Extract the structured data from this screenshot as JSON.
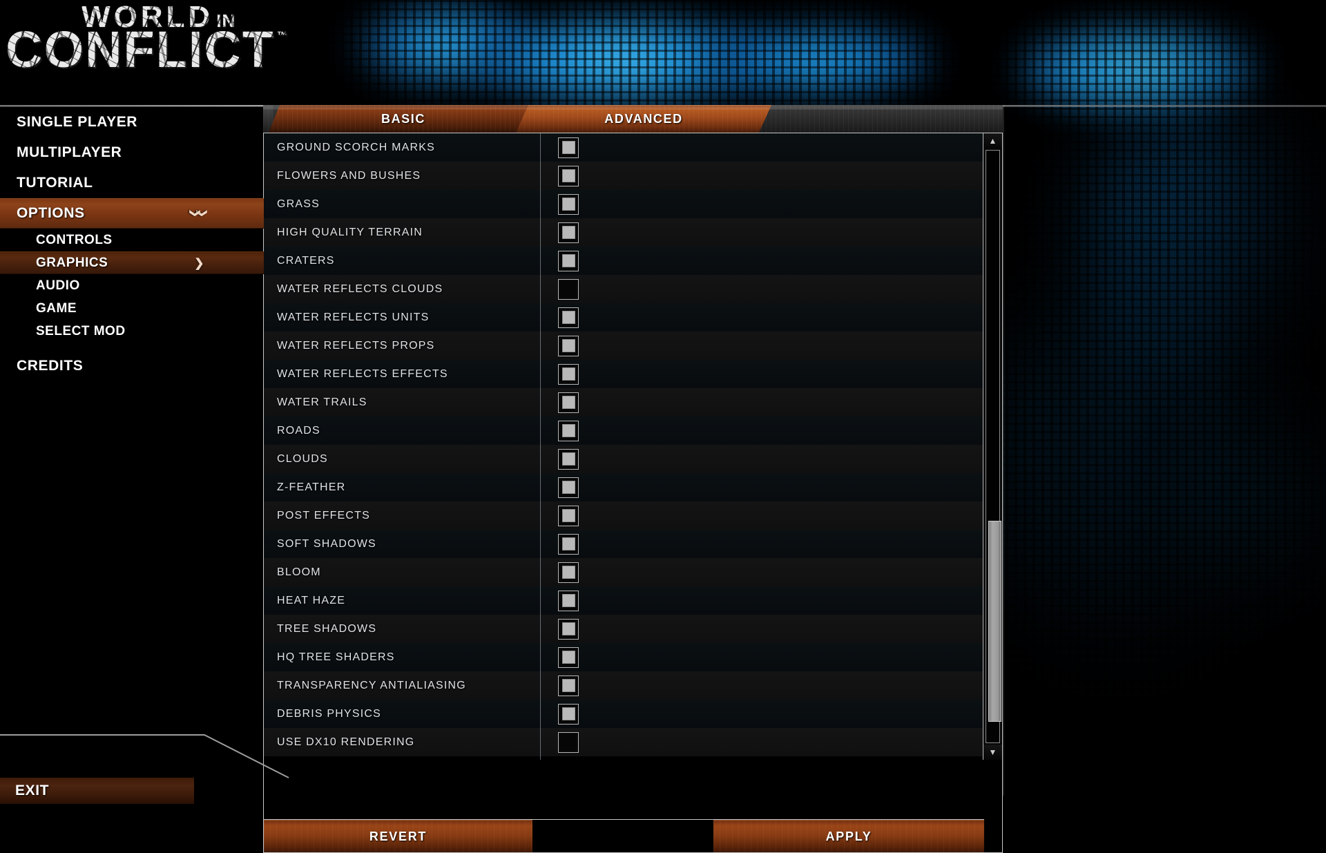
{
  "app": {
    "logo_line1": "WORLD",
    "logo_in": "IN",
    "logo_line2": "CONFLICT",
    "logo_tm": "™"
  },
  "sidebar": {
    "items": [
      {
        "label": "SINGLE PLAYER",
        "level": "top",
        "state": "normal",
        "chevron": ""
      },
      {
        "label": "MULTIPLAYER",
        "level": "top",
        "state": "normal",
        "chevron": ""
      },
      {
        "label": "TUTORIAL",
        "level": "top",
        "state": "normal",
        "chevron": ""
      },
      {
        "label": "OPTIONS",
        "level": "top",
        "state": "expanded",
        "chevron": "chevron-double-down-icon"
      },
      {
        "label": "CONTROLS",
        "level": "sub",
        "state": "normal",
        "chevron": ""
      },
      {
        "label": "GRAPHICS",
        "level": "sub",
        "state": "selected",
        "chevron": "chevron-right-icon"
      },
      {
        "label": "AUDIO",
        "level": "sub",
        "state": "normal",
        "chevron": ""
      },
      {
        "label": "GAME",
        "level": "sub",
        "state": "normal",
        "chevron": ""
      },
      {
        "label": "SELECT MOD",
        "level": "sub",
        "state": "normal",
        "chevron": ""
      },
      {
        "label": "CREDITS",
        "level": "top",
        "state": "normal",
        "chevron": ""
      }
    ],
    "exit_label": "EXIT"
  },
  "tabs": {
    "basic_label": "BASIC",
    "advanced_label": "ADVANCED",
    "active": "ADVANCED"
  },
  "settings": {
    "rows": [
      {
        "label": "GROUND SCORCH MARKS",
        "checked": true
      },
      {
        "label": "FLOWERS AND BUSHES",
        "checked": true
      },
      {
        "label": "GRASS",
        "checked": true
      },
      {
        "label": "HIGH QUALITY TERRAIN",
        "checked": true
      },
      {
        "label": "CRATERS",
        "checked": true
      },
      {
        "label": "WATER REFLECTS CLOUDS",
        "checked": false
      },
      {
        "label": "WATER REFLECTS UNITS",
        "checked": true
      },
      {
        "label": "WATER REFLECTS PROPS",
        "checked": true
      },
      {
        "label": "WATER REFLECTS EFFECTS",
        "checked": true
      },
      {
        "label": "WATER TRAILS",
        "checked": true
      },
      {
        "label": "ROADS",
        "checked": true
      },
      {
        "label": "CLOUDS",
        "checked": true
      },
      {
        "label": "Z-FEATHER",
        "checked": true
      },
      {
        "label": "POST EFFECTS",
        "checked": true
      },
      {
        "label": "SOFT SHADOWS",
        "checked": true
      },
      {
        "label": "BLOOM",
        "checked": true
      },
      {
        "label": "HEAT HAZE",
        "checked": true
      },
      {
        "label": "TREE SHADOWS",
        "checked": true
      },
      {
        "label": "HQ TREE SHADERS",
        "checked": true
      },
      {
        "label": "TRANSPARENCY ANTIALIASING",
        "checked": true
      },
      {
        "label": "DEBRIS PHYSICS",
        "checked": true
      },
      {
        "label": "USE DX10 RENDERING",
        "checked": false
      }
    ]
  },
  "scrollbar": {
    "up_arrow": "▲",
    "down_arrow": "▼"
  },
  "actions": {
    "revert_label": "REVERT",
    "apply_label": "APPLY"
  },
  "colors": {
    "accent_bright": "#9a4517",
    "accent_dark": "#4a2009",
    "panel_border": "#c9c9c9",
    "text": "#ffffff",
    "row_text": "#dfe2e5",
    "checkbox_fill": "#b9b9b9",
    "background_glow": "#23a3ec"
  }
}
